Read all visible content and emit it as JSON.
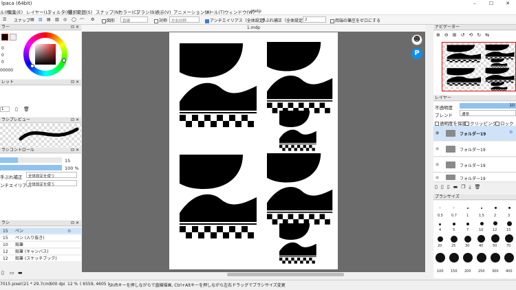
{
  "window": {
    "title": "lpaca (64bit)",
    "minimize": "–",
    "maximize": "☐",
    "close": "✕"
  },
  "menu": [
    "ル(F)",
    "編集(E)",
    "レイヤー(L)",
    "フィルタ(R)",
    "選択範囲(S)",
    "スナップ(N)",
    "カラー(C)",
    "ブラシ(B)",
    "表示(V)",
    "アニメーション(A)",
    "ツール(T)",
    "ウィンドウ(W)",
    "Help"
  ],
  "toolbar": {
    "snap_label": "スナップ",
    "shape_label": "図形",
    "shape_value": "直線",
    "symmetry_label": "対称",
    "symmetry_value": "左右対称",
    "antialias_label": "アンチエイリアス（全体設定）",
    "stabilizer_label": "手ぶれ補正（全体設定）",
    "stabilizer_value": "2",
    "alpha_zero_label": "両端の筆圧をゼロにする"
  },
  "document_tab": "1.mdp",
  "left": {
    "color_header": "ラー",
    "color_values": [
      "0",
      "0",
      "0",
      "00000"
    ],
    "palette_header": "レット",
    "palette_value": "1",
    "brush_preview_header": "ラシプレビュー",
    "brush_control_header": "ラシコントロール",
    "size_value": "15",
    "opacity_value": "100 %",
    "stabilizer_label": "手ぶれ補正",
    "stabilizer_value": "全体設定を使う",
    "antialias_label": "ンチエイリアス",
    "antialias_value": "全体設定を使う",
    "brush_header": "ラシ",
    "brushes": [
      {
        "size": "15",
        "name": "ペン",
        "selected": true
      },
      {
        "size": "15",
        "name": "ペン (入り抜き)",
        "selected": false
      },
      {
        "size": "10",
        "name": "鉛筆",
        "selected": false
      },
      {
        "size": "12",
        "name": "鉛筆 (キャンバス)",
        "selected": false
      },
      {
        "size": "12",
        "name": "鉛筆 (スケッチブック)",
        "selected": false
      }
    ]
  },
  "right": {
    "navigator_header": "ナビゲーター",
    "layer_header": "レイヤー",
    "opacity_label": "不透明度",
    "opacity_value": "10",
    "blend_label": "ブレンド",
    "blend_value": "通常",
    "protect_alpha": "透明度を保護",
    "clipping": "クリッピング",
    "lock": "ロック",
    "layers": [
      "フォルダー19",
      "フォルダー19",
      "フォルダー19",
      "フォルダー19"
    ],
    "brush_size_header": "ブラシサイズ",
    "brush_sizes_row1": [
      "0.5",
      "0.7",
      "1",
      "1.5",
      "2",
      "3"
    ],
    "brush_sizes_row2": [
      "4",
      "5",
      "7",
      "10",
      "12",
      "15"
    ],
    "brush_sizes_row3": [
      "20",
      "25",
      "30",
      "40",
      "50",
      "70"
    ],
    "brush_sizes_row4": [
      "100",
      "150",
      "200",
      "250",
      "300",
      "400"
    ]
  },
  "status": {
    "dims": "7015 pixel",
    "paper": "(21 * 29.7cm)",
    "dpi": "600 dpi",
    "zoom": "12 %",
    "coords": "( 6559, 4605 )",
    "hint": "Shiftキーを押しながらで直線描画, Ctrl+Altキーを押しながら左右ドラッグでブラシサイズ変更"
  },
  "colors": {
    "accent": "#3b7bd6",
    "selection": "#cfe3f8",
    "canvas_bg": "#6b6b6b"
  }
}
